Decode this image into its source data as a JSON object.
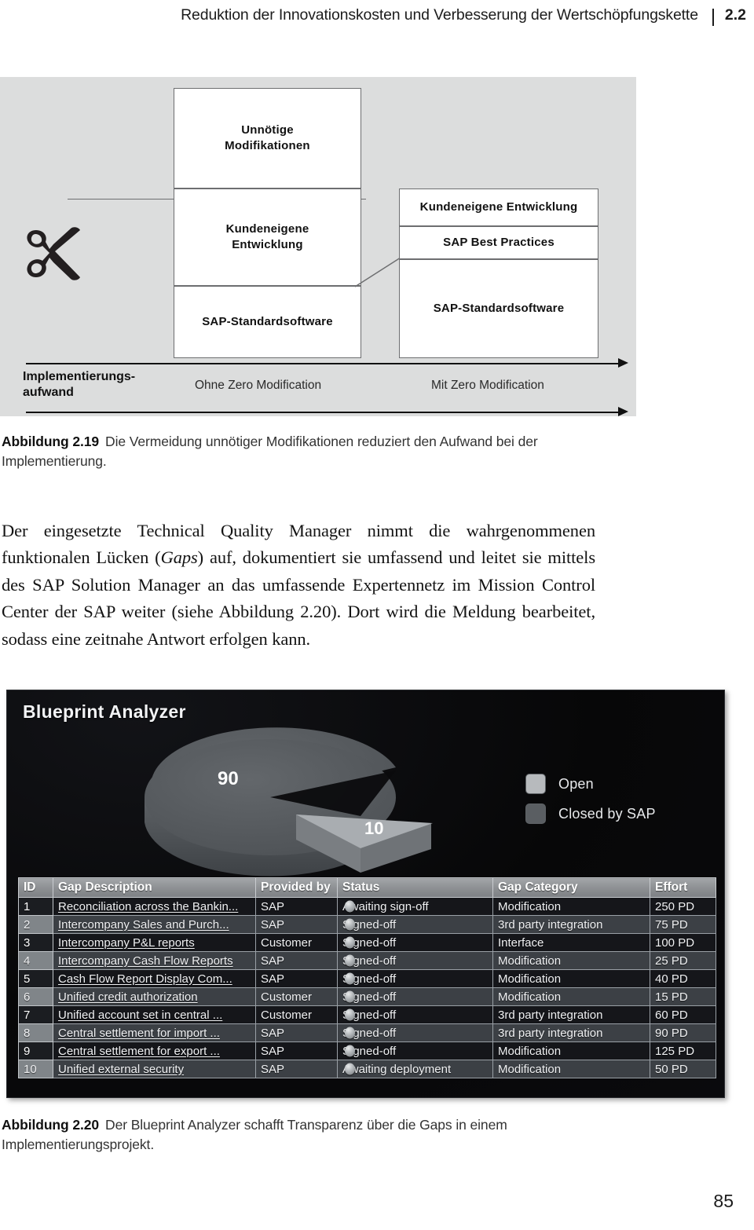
{
  "running_head": {
    "title": "Reduktion der Innovationskosten und Verbesserung der Wertschöpfungskette",
    "section_number": "2.2"
  },
  "figure_219": {
    "boxes": {
      "left_top": "Unnötige\nModifikationen",
      "left_top_line1": "Unnötige",
      "left_top_line2": "Modifikationen",
      "left_mid_line1": "Kundeneigene",
      "left_mid_line2": "Entwicklung",
      "left_bottom": "SAP-Standardsoftware",
      "right_top": "Kundeneigene Entwicklung",
      "right_mid": "SAP Best Practices",
      "right_bottom": "SAP-Standardsoftware"
    },
    "axis": {
      "y_label_line1": "Implementierungs-",
      "y_label_line2": "aufwand",
      "left_column_label": "Ohne Zero Modification",
      "right_column_label": "Mit Zero Modification"
    },
    "icons": {
      "scissors": "scissors-icon"
    },
    "caption_label": "Abbildung 2.19",
    "caption_text": "Die Vermeidung unnötiger Modifikationen reduziert den Aufwand bei der Implementierung."
  },
  "body_paragraph": {
    "part1": "Der eingesetzte Technical Quality Manager nimmt die wahrgenommenen funktionalen Lücken (",
    "italic1": "Gaps",
    "part2": ") auf, dokumentiert sie umfassend und leitet sie mittels des SAP Solution Manager an das umfassende Expertennetz im Mission Control Center der SAP weiter (siehe Abbildung 2.20). Dort wird die Meldung bearbeitet, sodass eine zeitnahe Antwort erfolgen kann."
  },
  "figure_220": {
    "app_title": "Blueprint Analyzer",
    "legend": [
      {
        "label": "Open",
        "color": "#b7babd"
      },
      {
        "label": "Closed by SAP",
        "color": "#5a5e62"
      }
    ],
    "chart_data": {
      "type": "pie",
      "title": "Blueprint Analyzer",
      "categories": [
        "Closed by SAP",
        "Open"
      ],
      "values": [
        90,
        10
      ],
      "data_labels": [
        "90",
        "10"
      ],
      "colors": [
        "#5a5e62",
        "#b7babd"
      ],
      "legend_position": "right",
      "exploded_slice": "Open",
      "three_d": true
    },
    "table": {
      "columns": [
        "ID",
        "Gap Description",
        "Provided by",
        "Status",
        "Gap Category",
        "Effort"
      ],
      "rows": [
        {
          "id": "1",
          "desc": "Reconciliation across the Bankin...",
          "provided_by": "SAP",
          "status": "Awaiting sign-off",
          "category": "Modification",
          "effort": "250 PD"
        },
        {
          "id": "2",
          "desc": "Intercompany Sales and Purch...",
          "provided_by": "SAP",
          "status": "Signed-off",
          "category": "3rd party integration",
          "effort": "75 PD"
        },
        {
          "id": "3",
          "desc": "Intercompany P&L reports",
          "provided_by": "Customer",
          "status": "Signed-off",
          "category": "Interface",
          "effort": "100 PD"
        },
        {
          "id": "4",
          "desc": "Intercompany Cash Flow Reports",
          "provided_by": "SAP",
          "status": "Signed-off",
          "category": "Modification",
          "effort": "25 PD"
        },
        {
          "id": "5",
          "desc": "Cash Flow Report Display Com...",
          "provided_by": "SAP",
          "status": "Signed-off",
          "category": "Modification",
          "effort": "40 PD"
        },
        {
          "id": "6",
          "desc": "Unified credit authorization",
          "provided_by": "Customer",
          "status": "Signed-off",
          "category": "Modification",
          "effort": "15 PD"
        },
        {
          "id": "7",
          "desc": "Unified account set in central ...",
          "provided_by": "Customer",
          "status": "Signed-off",
          "category": "3rd party integration",
          "effort": "60 PD"
        },
        {
          "id": "8",
          "desc": "Central settlement for import ...",
          "provided_by": "SAP",
          "status": "Signed-off",
          "category": "3rd party integration",
          "effort": "90 PD"
        },
        {
          "id": "9",
          "desc": "Central settlement for export ...",
          "provided_by": "SAP",
          "status": "Signed-off",
          "category": "Modification",
          "effort": "125 PD"
        },
        {
          "id": "10",
          "desc": "Unified external security",
          "provided_by": "SAP",
          "status": "Awaiting deployment",
          "category": "Modification",
          "effort": "50 PD"
        }
      ]
    },
    "caption_label": "Abbildung 2.20",
    "caption_text": "Der Blueprint Analyzer schafft Transparenz über die Gaps in einem Implementierungsprojekt."
  },
  "page_number": "85"
}
